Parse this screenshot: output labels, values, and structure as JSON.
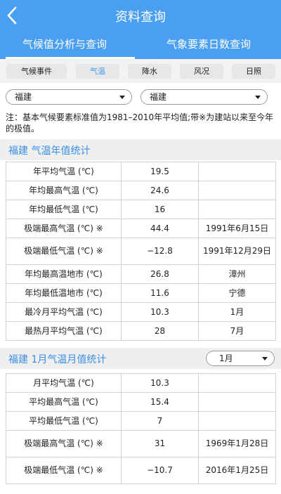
{
  "header": {
    "title": "资料查询"
  },
  "tabs": [
    {
      "label": "气候值分析与查询"
    },
    {
      "label": "气象要素日数查询"
    }
  ],
  "categories": [
    {
      "label": "气候事件"
    },
    {
      "label": "气温"
    },
    {
      "label": "降水"
    },
    {
      "label": "风况"
    },
    {
      "label": "日照"
    }
  ],
  "selectors": {
    "province": "福建",
    "station": "福建"
  },
  "note": "注：基本气候要素标准值为1981–2010年平均值;带※为建站以来至今年的极值。",
  "annual": {
    "title": "福建 气温年值统计",
    "rows": [
      {
        "label": "年平均气温 (℃)",
        "value": "19.5",
        "extra": ""
      },
      {
        "label": "年均最高气温 (℃)",
        "value": "24.6",
        "extra": ""
      },
      {
        "label": "年均最低气温 (℃)",
        "value": "16",
        "extra": ""
      },
      {
        "label": "极端最高气温 (℃) ※",
        "value": "44.4",
        "extra": "1991年6月15日"
      },
      {
        "label": "极端最低气温 (℃) ※",
        "value": "−12.8",
        "extra": "1991年12月29日"
      },
      {
        "label": "年均最高温地市 (℃)",
        "value": "26.8",
        "extra": "漳州"
      },
      {
        "label": "年均最低温地市 (℃)",
        "value": "11.6",
        "extra": "宁德"
      },
      {
        "label": "最冷月平均气温 (℃)",
        "value": "10.3",
        "extra": "1月"
      },
      {
        "label": "最热月平均气温 (℃)",
        "value": "28",
        "extra": "7月"
      }
    ]
  },
  "monthly": {
    "title": "福建 1月气温月值统计",
    "month": "1月",
    "rows": [
      {
        "label": "月平均气温 (℃)",
        "value": "10.3",
        "extra": ""
      },
      {
        "label": "平均最高气温 (℃)",
        "value": "15.4",
        "extra": ""
      },
      {
        "label": "平均最低气温 (℃)",
        "value": "7",
        "extra": ""
      },
      {
        "label": "极端最高气温 (℃) ※",
        "value": "31",
        "extra": "1969年1月28日"
      },
      {
        "label": "极端最低气温 (℃) ※",
        "value": "−10.7",
        "extra": "2016年1月25日"
      }
    ]
  },
  "colors": {
    "primary": "#4a9ff0",
    "section_title": "#3b8fe6"
  }
}
